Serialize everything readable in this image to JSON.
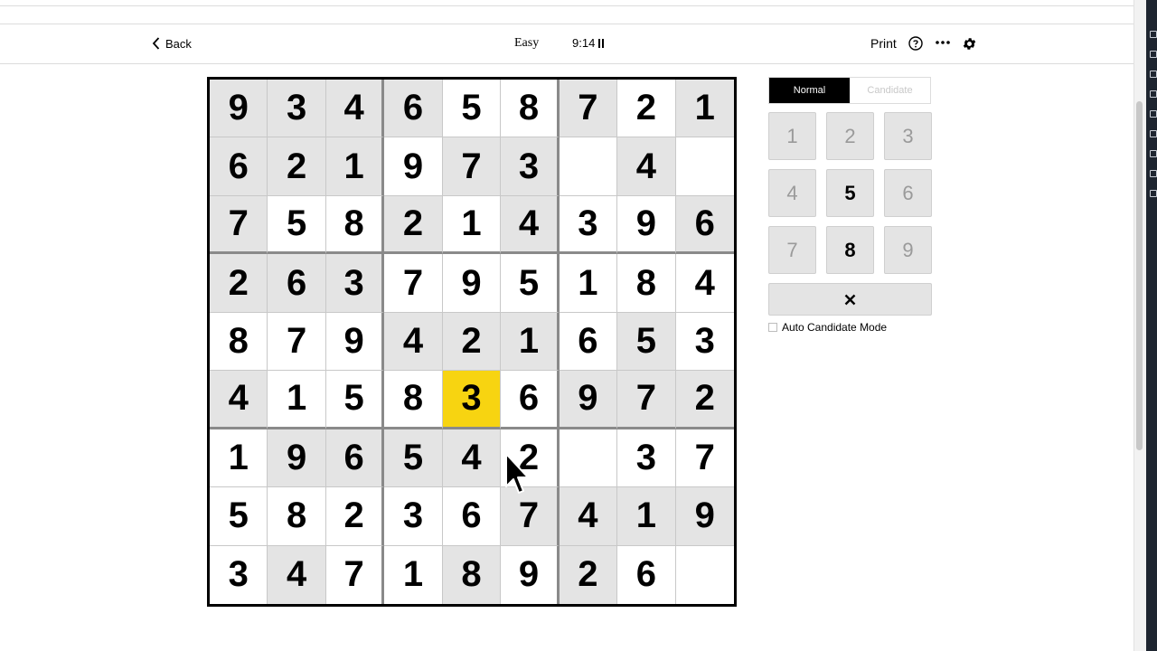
{
  "header": {
    "back_label": "Back",
    "difficulty": "Easy",
    "timer": "9:14",
    "print_label": "Print"
  },
  "board": {
    "selected": [
      5,
      4
    ],
    "cells": [
      [
        "9",
        "3",
        "4",
        "6",
        "5",
        "8",
        "7",
        "2",
        "1"
      ],
      [
        "6",
        "2",
        "1",
        "9",
        "7",
        "3",
        "",
        "4",
        ""
      ],
      [
        "7",
        "5",
        "8",
        "2",
        "1",
        "4",
        "3",
        "9",
        "6"
      ],
      [
        "2",
        "6",
        "3",
        "7",
        "9",
        "5",
        "1",
        "8",
        "4"
      ],
      [
        "8",
        "7",
        "9",
        "4",
        "2",
        "1",
        "6",
        "5",
        "3"
      ],
      [
        "4",
        "1",
        "5",
        "8",
        "3",
        "6",
        "9",
        "7",
        "2"
      ],
      [
        "1",
        "9",
        "6",
        "5",
        "4",
        "2",
        "",
        "3",
        "7"
      ],
      [
        "5",
        "8",
        "2",
        "3",
        "6",
        "7",
        "4",
        "1",
        "9"
      ],
      [
        "3",
        "4",
        "7",
        "1",
        "8",
        "9",
        "2",
        "6",
        ""
      ]
    ],
    "gray": [
      [
        1,
        1,
        1,
        1,
        0,
        0,
        1,
        0,
        1
      ],
      [
        1,
        1,
        1,
        0,
        1,
        1,
        0,
        1,
        0
      ],
      [
        1,
        0,
        0,
        1,
        0,
        1,
        0,
        0,
        1
      ],
      [
        1,
        1,
        1,
        0,
        0,
        0,
        0,
        0,
        0
      ],
      [
        0,
        0,
        0,
        1,
        1,
        1,
        0,
        1,
        0
      ],
      [
        1,
        0,
        0,
        0,
        0,
        0,
        1,
        1,
        1
      ],
      [
        0,
        1,
        1,
        1,
        1,
        0,
        0,
        0,
        0
      ],
      [
        0,
        0,
        0,
        0,
        0,
        1,
        1,
        1,
        1
      ],
      [
        0,
        1,
        0,
        0,
        1,
        0,
        1,
        0,
        0
      ]
    ]
  },
  "panel": {
    "mode_normal": "Normal",
    "mode_candidate": "Candidate",
    "keys": [
      {
        "label": "1",
        "active": false
      },
      {
        "label": "2",
        "active": false
      },
      {
        "label": "3",
        "active": false
      },
      {
        "label": "4",
        "active": false
      },
      {
        "label": "5",
        "active": true
      },
      {
        "label": "6",
        "active": false
      },
      {
        "label": "7",
        "active": false
      },
      {
        "label": "8",
        "active": true
      },
      {
        "label": "9",
        "active": false
      }
    ],
    "auto_candidate_label": "Auto Candidate Mode"
  },
  "colors": {
    "selected_cell": "#f7d411",
    "given_cell": "#e4e4e4",
    "mode_active_bg": "#000000"
  },
  "icons": [
    "chevron-left-icon",
    "pause-icon",
    "help-icon",
    "more-icon",
    "gear-icon",
    "close-icon"
  ]
}
